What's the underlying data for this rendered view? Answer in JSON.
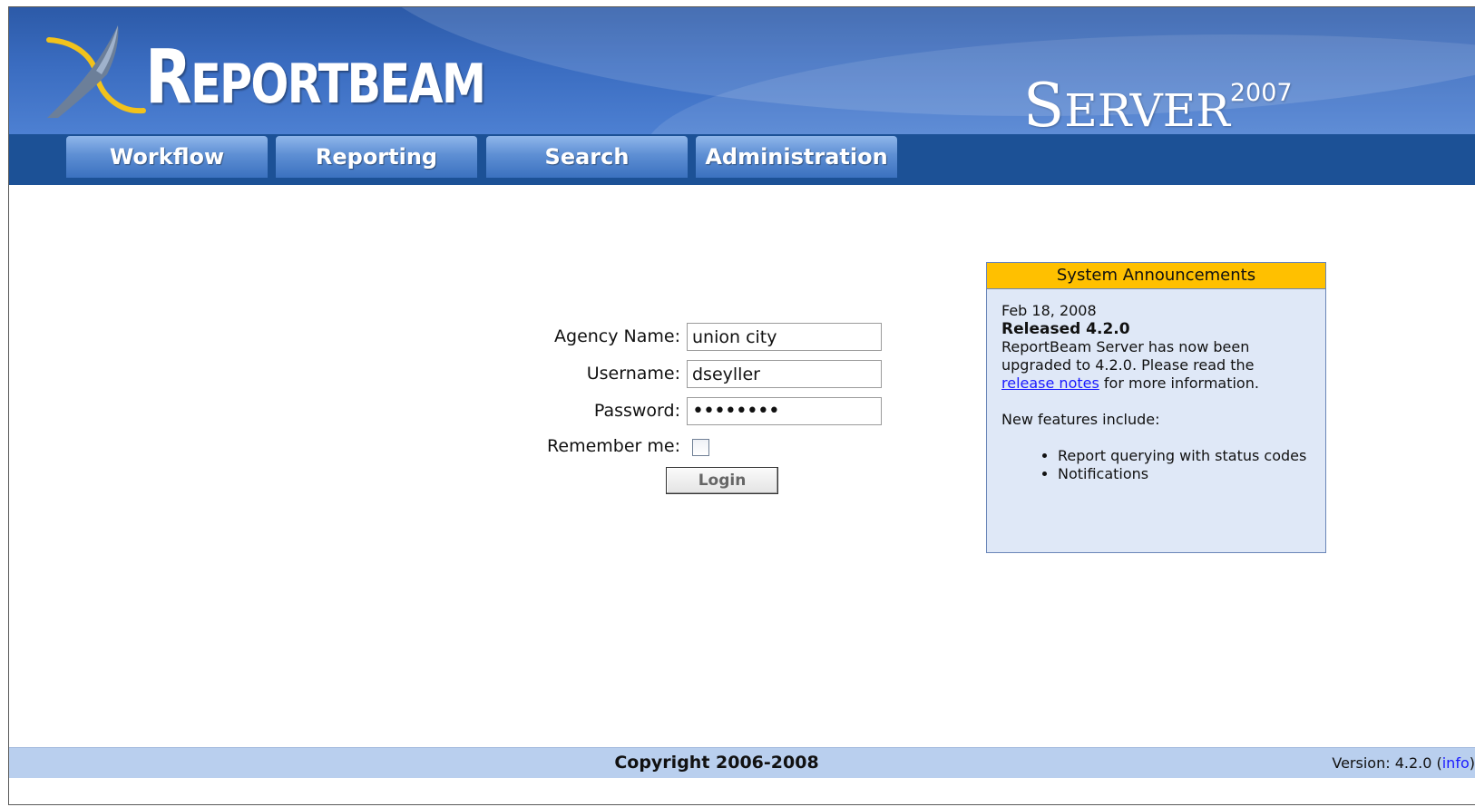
{
  "header": {
    "logo_text_first": "R",
    "logo_text_rest": "EPORTBEAM",
    "product_text_first": "S",
    "product_text_rest": "ERVER",
    "product_year": "2007"
  },
  "nav": {
    "tabs": [
      {
        "label": "Workflow"
      },
      {
        "label": "Reporting"
      },
      {
        "label": "Search"
      },
      {
        "label": "Administration"
      }
    ]
  },
  "login": {
    "agency_label": "Agency Name:",
    "agency_value": "union city",
    "username_label": "Username:",
    "username_value": "dseyller",
    "password_label": "Password:",
    "password_value": "••••••••",
    "remember_label": "Remember me:",
    "remember_checked": false,
    "login_button": "Login"
  },
  "announcements": {
    "title": "System Announcements",
    "date": "Feb 18, 2008",
    "headline": "Released 4.2.0",
    "body_line1": "ReportBeam Server has now been",
    "body_line2": "upgraded to 4.2.0. Please read the",
    "link_text": "release notes",
    "body_after_link": " for more information.",
    "features_intro": "New features include:",
    "features": [
      "Report querying with status codes",
      "Notifications"
    ]
  },
  "footer": {
    "copyright": "Copyright 2006-2008",
    "version_prefix": "Version: 4.2.0 (",
    "version_link": "info",
    "version_suffix": ")"
  },
  "colors": {
    "banner": "#3a6cc0",
    "navbar": "#1c5196",
    "announce_header": "#ffc000",
    "announce_bg": "#dfe8f7",
    "footer": "#b9cfee",
    "link": "#1a1aff"
  }
}
